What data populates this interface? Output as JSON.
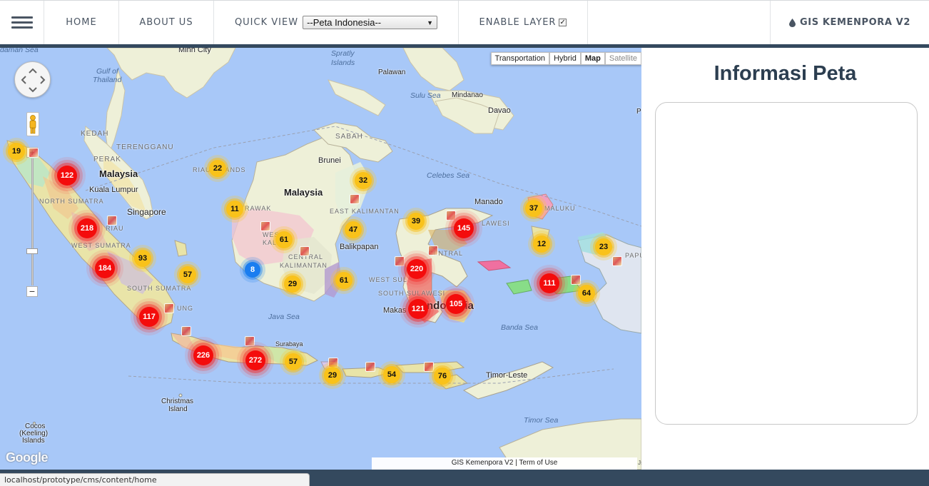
{
  "nav": {
    "home": "HOME",
    "about": "ABOUT US",
    "quick_view_label": "QUICK VIEW",
    "quick_view_selected": "--Peta Indonesia--",
    "enable_layer_label": "ENABLE LAYER",
    "enable_layer_checked": true,
    "brand": "GIS KEMENPORA V2"
  },
  "map": {
    "type_buttons": [
      "Transportation",
      "Hybrid",
      "Map",
      "Satellite"
    ],
    "active_type": "Map",
    "labels": {
      "andaman_sea": "daman Sea",
      "minh_city": "Minh City",
      "spratly": "Spratly",
      "islands": "Islands",
      "gulf_of": "Gulf of",
      "thailand": "Thailand",
      "palawan": "Palawan",
      "sulu_sea": "Sulu Sea",
      "mindanao": "Mindanao",
      "davao": "Davao",
      "kedah": "KEDAH",
      "terengganu": "TERENGGANU",
      "perak": "PERAK",
      "malaysia_w": "Malaysia",
      "kuala_lumpur": "Kuala Lumpur",
      "north_sumatra": "NORTH SUMATRA",
      "singapore": "Singapore",
      "riau": "RIAU",
      "west_sumatra": "WEST SUMATRA",
      "south_sumatra": "SOUTH SUMATRA",
      "lampung": "UNG",
      "riau_islands": "RIAU ISLANDS",
      "sabah": "SABAH",
      "brunei": "Brunei",
      "malaysia_e": "Malaysia",
      "sarawak": "RAWAK",
      "east_kalimantan": "EAST KALIMANTAN",
      "west_kalimantan_1": "WES",
      "west_kalimantan_2": "KALIMA",
      "central_kalimantan_1": "CENTRAL",
      "central_kalimantan_2": "KALIMANTAN",
      "balikpapan": "Balikpapan",
      "celebes_sea": "Celebes Sea",
      "manado": "Manado",
      "north_maluku": "MALUKU",
      "sulawesi": "LAWESI",
      "central_sulawesi": "CENTRAL",
      "west_sulawesi": "WEST SUL",
      "south_sulawesi": "SOUTH SULAWESI",
      "makassar": "Makas",
      "indonesia": "ndonesia",
      "java_sea": "Java Sea",
      "banda_sea": "Banda Sea",
      "papua": "PAPU",
      "surabaya": "Surabaya",
      "timor_leste": "Timor-Leste",
      "timor_sea": "Timor Sea",
      "christmas": "Christmas",
      "island": "Island",
      "cocos": "Cocos",
      "keeling": "(Keeling)",
      "cocos_islands": "Islands",
      "p_edge": "P"
    },
    "clusters": [
      {
        "id": "c19",
        "value": "19",
        "level": "yellow"
      },
      {
        "id": "c122",
        "value": "122",
        "level": "red"
      },
      {
        "id": "c218",
        "value": "218",
        "level": "red"
      },
      {
        "id": "c93",
        "value": "93",
        "level": "yellow"
      },
      {
        "id": "c184",
        "value": "184",
        "level": "red"
      },
      {
        "id": "c57a",
        "value": "57",
        "level": "yellow"
      },
      {
        "id": "c117",
        "value": "117",
        "level": "red"
      },
      {
        "id": "c22",
        "value": "22",
        "level": "yellow"
      },
      {
        "id": "c11",
        "value": "11",
        "level": "yellow"
      },
      {
        "id": "c61a",
        "value": "61",
        "level": "yellow"
      },
      {
        "id": "c8",
        "value": "8",
        "level": "blue"
      },
      {
        "id": "c29a",
        "value": "29",
        "level": "yellow"
      },
      {
        "id": "c32",
        "value": "32",
        "level": "yellow"
      },
      {
        "id": "c47",
        "value": "47",
        "level": "yellow"
      },
      {
        "id": "c61b",
        "value": "61",
        "level": "yellow"
      },
      {
        "id": "c39",
        "value": "39",
        "level": "yellow"
      },
      {
        "id": "c145",
        "value": "145",
        "level": "red"
      },
      {
        "id": "c37",
        "value": "37",
        "level": "yellow"
      },
      {
        "id": "c12",
        "value": "12",
        "level": "yellow"
      },
      {
        "id": "c23",
        "value": "23",
        "level": "yellow"
      },
      {
        "id": "c220",
        "value": "220",
        "level": "red"
      },
      {
        "id": "c121",
        "value": "121",
        "level": "red"
      },
      {
        "id": "c105",
        "value": "105",
        "level": "red"
      },
      {
        "id": "c111",
        "value": "111",
        "level": "red"
      },
      {
        "id": "c64",
        "value": "64",
        "level": "yellow"
      },
      {
        "id": "c226",
        "value": "226",
        "level": "red"
      },
      {
        "id": "c272",
        "value": "272",
        "level": "red"
      },
      {
        "id": "c57b",
        "value": "57",
        "level": "yellow"
      },
      {
        "id": "c29b",
        "value": "29",
        "level": "yellow"
      },
      {
        "id": "c54",
        "value": "54",
        "level": "yellow"
      },
      {
        "id": "c76",
        "value": "76",
        "level": "yellow"
      }
    ],
    "google_logo": "Google",
    "attribution_name": "GIS Kemenpora V2",
    "attribution_sep": "|",
    "attribution_link": "Term of Use",
    "edge_text": "Js",
    "icons": {
      "pan": "pan-arrows-icon",
      "pegman": "pegman-icon",
      "zoom_in": "+",
      "zoom_out": "−"
    }
  },
  "panel": {
    "title": "Informasi Peta"
  },
  "status_bar": {
    "url": "localhost/prototype/cms/content/home"
  },
  "colors": {
    "nav_text": "#4a5563",
    "dark_bar": "#34495e",
    "panel_title": "#2c3e50",
    "sea": "#a8c8f8",
    "marker_red": "#f40c0c",
    "marker_yellow": "#f9c21a",
    "marker_blue": "#1a7df0"
  }
}
